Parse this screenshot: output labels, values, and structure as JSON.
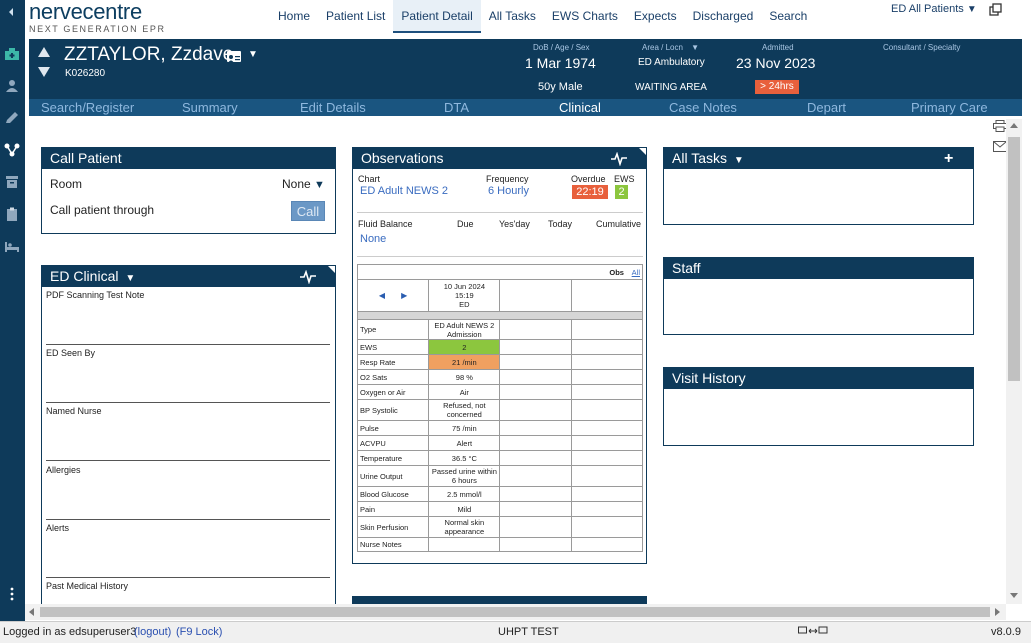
{
  "brand": {
    "name": "nervecentre",
    "tagline": "NEXT GENERATION EPR"
  },
  "topnav": {
    "items": [
      "Home",
      "Patient List",
      "Patient Detail",
      "All Tasks",
      "EWS Charts",
      "Expects",
      "Discharged",
      "Search"
    ],
    "active": "Patient Detail",
    "patient_list_selector": "ED All Patients"
  },
  "sidebar": {
    "icons": [
      "collapse-arrow-icon",
      "hospital-icon",
      "person-icon",
      "pencil-icon",
      "flow-icon",
      "archive-icon",
      "clipboard-icon",
      "bed-icon",
      "more-icon"
    ]
  },
  "patient": {
    "name": "ZZTAYLOR, Zzdave",
    "mrn": "K026280",
    "dob_label": "DoB / Age / Sex",
    "dob": "1 Mar 1974",
    "age_sex": "50y Male",
    "area_label": "Area / Locn",
    "area": "ED Ambulatory",
    "location": "WAITING AREA",
    "admitted_label": "Admitted",
    "admitted": "23 Nov 2023",
    "duration_badge": "> 24hrs",
    "consultant_label": "Consultant / Specialty"
  },
  "subnav": {
    "tabs": [
      "Search/Register",
      "Summary",
      "Edit Details",
      "DTA",
      "Clinical",
      "Case Notes",
      "Depart",
      "Primary Care"
    ],
    "active": "Clinical"
  },
  "call_patient": {
    "title": "Call Patient",
    "room_label": "Room",
    "room_value": "None",
    "call_through_label": "Call patient through",
    "call_button": "Call"
  },
  "ed_clinical": {
    "title": "ED Clinical",
    "fields": [
      "PDF Scanning Test Note",
      "ED Seen By",
      "Named Nurse",
      "Allergies",
      "Alerts",
      "Past Medical History"
    ]
  },
  "observations": {
    "title": "Observations",
    "chart_label": "Chart",
    "chart_value": "ED Adult NEWS 2",
    "frequency_label": "Frequency",
    "frequency_value": "6 Hourly",
    "overdue_label": "Overdue",
    "overdue_value": "22:19",
    "ews_label": "EWS",
    "ews_value": "2",
    "fluid_label": "Fluid Balance",
    "fluid_value": "None",
    "fluid_cols": [
      "Due",
      "Yes'day",
      "Today",
      "Cumulative"
    ],
    "obs_toggle": "Obs",
    "all_link": "All",
    "date_col": [
      "10 Jun 2024",
      "15:19",
      "ED"
    ],
    "rows": [
      {
        "label": "Type",
        "value": "ED Adult NEWS 2 Admission"
      },
      {
        "label": "EWS",
        "value": "2"
      },
      {
        "label": "Resp Rate",
        "value": "21 /min"
      },
      {
        "label": "O2 Sats",
        "value": "98 %"
      },
      {
        "label": "Oxygen or Air",
        "value": "Air"
      },
      {
        "label": "BP Systolic",
        "value": "Refused, not concerned"
      },
      {
        "label": "Pulse",
        "value": "75 /min"
      },
      {
        "label": "ACVPU",
        "value": "Alert"
      },
      {
        "label": "Temperature",
        "value": "36.5 °C"
      },
      {
        "label": "Urine Output",
        "value": "Passed urine within 6 hours"
      },
      {
        "label": "Blood Glucose",
        "value": "2.5 mmol/l"
      },
      {
        "label": "Pain",
        "value": "Mild"
      },
      {
        "label": "Skin Perfusion",
        "value": "Normal skin appearance"
      },
      {
        "label": "Nurse Notes",
        "value": ""
      }
    ],
    "highlight_colors": {
      "ews": "#8cc63e",
      "resp_rate": "#f0a060",
      "overdue": "#e8603c"
    }
  },
  "all_tasks": {
    "title": "All Tasks"
  },
  "staff": {
    "title": "Staff"
  },
  "visit_history": {
    "title": "Visit History"
  },
  "footer": {
    "logged_in": "Logged in as edsuperuser3",
    "logout": "(logout)",
    "lock": "(F9 Lock)",
    "env": "UHPT TEST",
    "version": "v8.0.9"
  }
}
